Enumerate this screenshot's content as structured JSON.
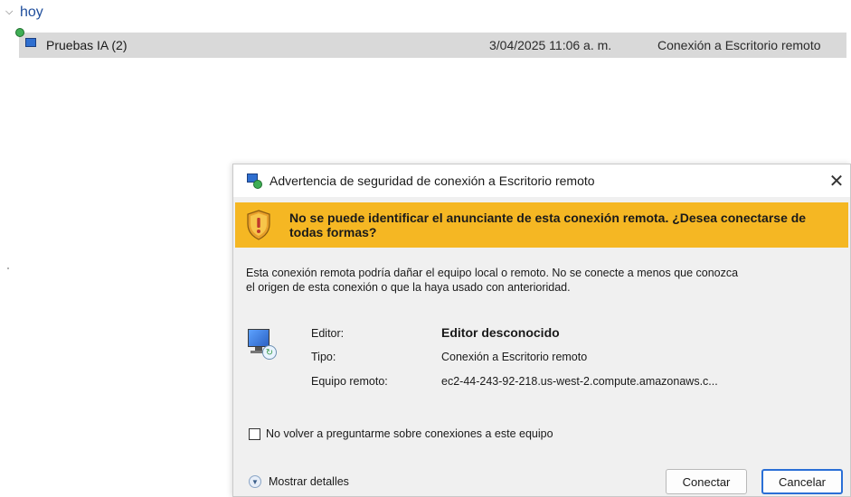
{
  "explorer": {
    "group_label": "hoy",
    "file": {
      "name": "Pruebas IA (2)",
      "date": "3/04/2025 11:06 a. m.",
      "type": "Conexión a Escritorio remoto"
    }
  },
  "dialog": {
    "title": "Advertencia de seguridad de conexión a Escritorio remoto",
    "close_label": "✕",
    "warning_message": "No se puede identificar el anunciante de esta conexión remota. ¿Desea conectarse de todas formas?",
    "description_line1": "Esta conexión remota podría dañar el equipo local o remoto. No se conecte a menos que conozca",
    "description_line2": "el origen de esta conexión o que la haya usado con anterioridad.",
    "info": {
      "editor_label": "Editor:",
      "editor_value": "Editor desconocido",
      "type_label": "Tipo:",
      "type_value": "Conexión a Escritorio remoto",
      "remote_label": "Equipo remoto:",
      "remote_value": "ec2-44-243-92-218.us-west-2.compute.amazonaws.c..."
    },
    "checkbox_label": "No volver a preguntarme sobre conexiones a este equipo",
    "checkbox_checked": false,
    "details_label": "Mostrar detalles",
    "connect_label": "Conectar",
    "cancel_label": "Cancelar"
  },
  "colors": {
    "warning_bar": "#f5b723",
    "focus_border": "#2a6fd6",
    "group_header": "#1f4e9c"
  },
  "icons": [
    "chevron-down-icon",
    "remote-desktop-icon",
    "shield-warning-icon",
    "close-icon",
    "expand-details-icon"
  ]
}
